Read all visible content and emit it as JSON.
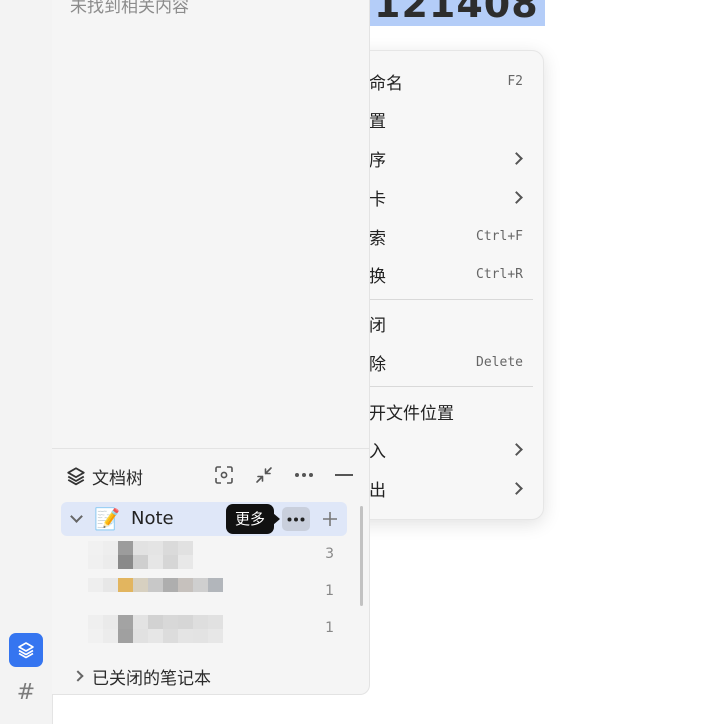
{
  "heading": {
    "text": "121408"
  },
  "context_menu": {
    "items": [
      {
        "label": "命名",
        "shortcut": "F2",
        "submenu": false
      },
      {
        "label": "置",
        "shortcut": "",
        "submenu": false
      },
      {
        "label": "序",
        "shortcut": "",
        "submenu": true
      },
      {
        "label": "卡",
        "shortcut": "",
        "submenu": true
      },
      {
        "label": "索",
        "shortcut": "Ctrl+F",
        "submenu": false
      },
      {
        "label": "换",
        "shortcut": "Ctrl+R",
        "submenu": false
      },
      {
        "label": "闭",
        "shortcut": "",
        "submenu": false
      },
      {
        "label": "除",
        "shortcut": "Delete",
        "submenu": false
      },
      {
        "label": "开文件位置",
        "shortcut": "",
        "submenu": false
      },
      {
        "label": "入",
        "shortcut": "",
        "submenu": true
      },
      {
        "label": "出",
        "shortcut": "",
        "submenu": true
      }
    ]
  },
  "sidebar": {
    "search_empty": "未找到相关内容",
    "tree_title": "文档树",
    "notebook": {
      "emoji": "📝",
      "name": "Note"
    },
    "tooltip": "更多",
    "docs": [
      {
        "count": "3"
      },
      {
        "count": "1"
      },
      {
        "count": "1"
      }
    ],
    "closed_notebooks": "已关闭的笔记本"
  },
  "dock": {
    "icons": [
      "layers-icon",
      "hash-icon"
    ],
    "hash_glyph": "#"
  },
  "colors": {
    "accent": "#3575f0",
    "selection": "#b4cdf8",
    "notebook_row": "#dfe7f8"
  }
}
